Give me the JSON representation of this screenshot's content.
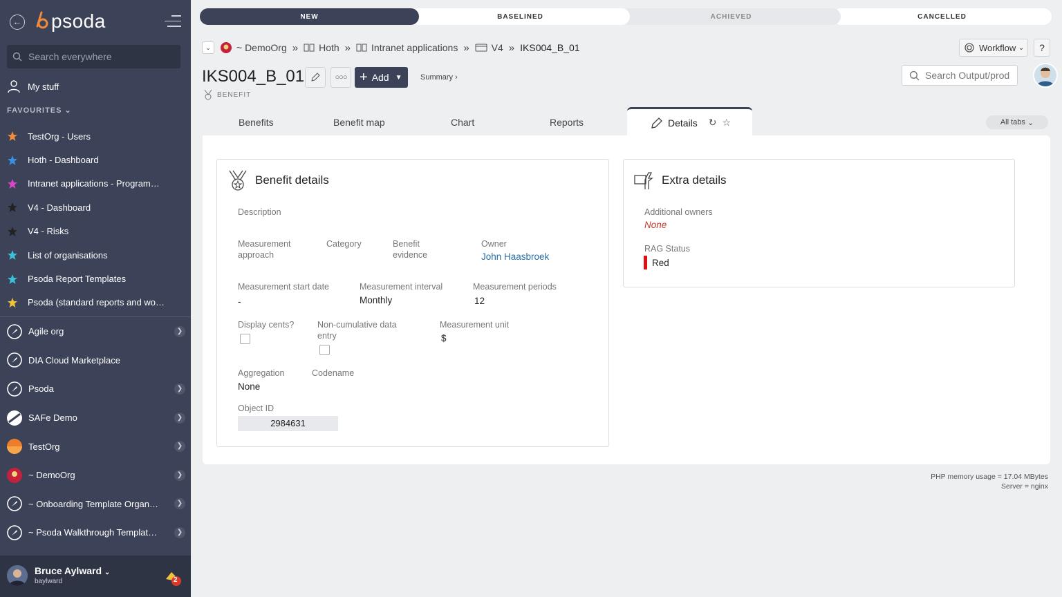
{
  "sidebar": {
    "logo_text": "psoda",
    "search_placeholder": "Search everywhere",
    "my_stuff": "My stuff",
    "favourites_heading": "FAVOURITES",
    "favourites": [
      {
        "label": "TestOrg - Users",
        "color": "#f08a3c"
      },
      {
        "label": "Hoth - Dashboard",
        "color": "#3b8fe0"
      },
      {
        "label": "Intranet applications - Programme...",
        "color": "#d846c8"
      },
      {
        "label": "V4 - Dashboard",
        "color": "#222222"
      },
      {
        "label": "V4 - Risks",
        "color": "#222222"
      },
      {
        "label": "List of organisations",
        "color": "#3cc0d8"
      },
      {
        "label": "Psoda Report Templates",
        "color": "#3cc0d8"
      },
      {
        "label": "Psoda (standard reports and work...",
        "color": "#f0c23c"
      }
    ],
    "organisations": [
      {
        "label": "Agile org",
        "chevron": true,
        "type": "psoda"
      },
      {
        "label": "DIA Cloud Marketplace",
        "chevron": false,
        "type": "psoda"
      },
      {
        "label": "Psoda",
        "chevron": true,
        "type": "psoda"
      },
      {
        "label": "SAFe Demo",
        "chevron": true,
        "type": "safe"
      },
      {
        "label": "TestOrg",
        "chevron": true,
        "type": "orange"
      },
      {
        "label": "~ DemoOrg",
        "chevron": true,
        "type": "red"
      },
      {
        "label": "~ Onboarding Template Organisa...",
        "chevron": true,
        "type": "psoda"
      },
      {
        "label": "~ Psoda Walkthrough Template P...",
        "chevron": true,
        "type": "psoda"
      }
    ],
    "user": {
      "name": "Bruce Aylward",
      "username": "baylward",
      "notifications": "2"
    }
  },
  "progress": {
    "stages": [
      "NEW",
      "BASELINED",
      "ACHIEVED",
      "CANCELLED"
    ],
    "active": "NEW"
  },
  "breadcrumb": {
    "items": [
      "~ DemoOrg",
      "Hoth",
      "Intranet applications",
      "V4",
      "IKS004_B_01"
    ],
    "separator": "»"
  },
  "header": {
    "title": "IKS004_B_01",
    "type_label": "BENEFIT",
    "add_label": "Add",
    "summary_label": "Summary ›",
    "workflow_label": "Workflow",
    "help_label": "?",
    "search_placeholder": "Search Output/prod"
  },
  "tabs": {
    "items": [
      "Benefits",
      "Benefit map",
      "Chart",
      "Reports"
    ],
    "active": "Details",
    "all_tabs": "All tabs"
  },
  "benefit_details": {
    "heading": "Benefit details",
    "description_label": "Description",
    "measurement_approach_label": "Measurement approach",
    "category_label": "Category",
    "benefit_evidence_label": "Benefit evidence",
    "owner_label": "Owner",
    "owner_value": "John Haasbroek",
    "start_date_label": "Measurement start date",
    "start_date_value": "-",
    "interval_label": "Measurement interval",
    "interval_value": "Monthly",
    "periods_label": "Measurement periods",
    "periods_value": "12",
    "display_cents_label": "Display cents?",
    "noncumulative_label": "Non-cumulative data entry",
    "unit_label": "Measurement unit",
    "unit_value": "$",
    "aggregation_label": "Aggregation",
    "aggregation_value": "None",
    "codename_label": "Codename",
    "object_id_label": "Object ID",
    "object_id_value": "2984631"
  },
  "extra_details": {
    "heading": "Extra details",
    "owners_label": "Additional owners",
    "owners_value": "None",
    "rag_label": "RAG Status",
    "rag_value": "Red",
    "rag_color": "#dd1111"
  },
  "footer": {
    "memory": "PHP memory usage = 17.04 MBytes",
    "server": "Server = nginx"
  }
}
